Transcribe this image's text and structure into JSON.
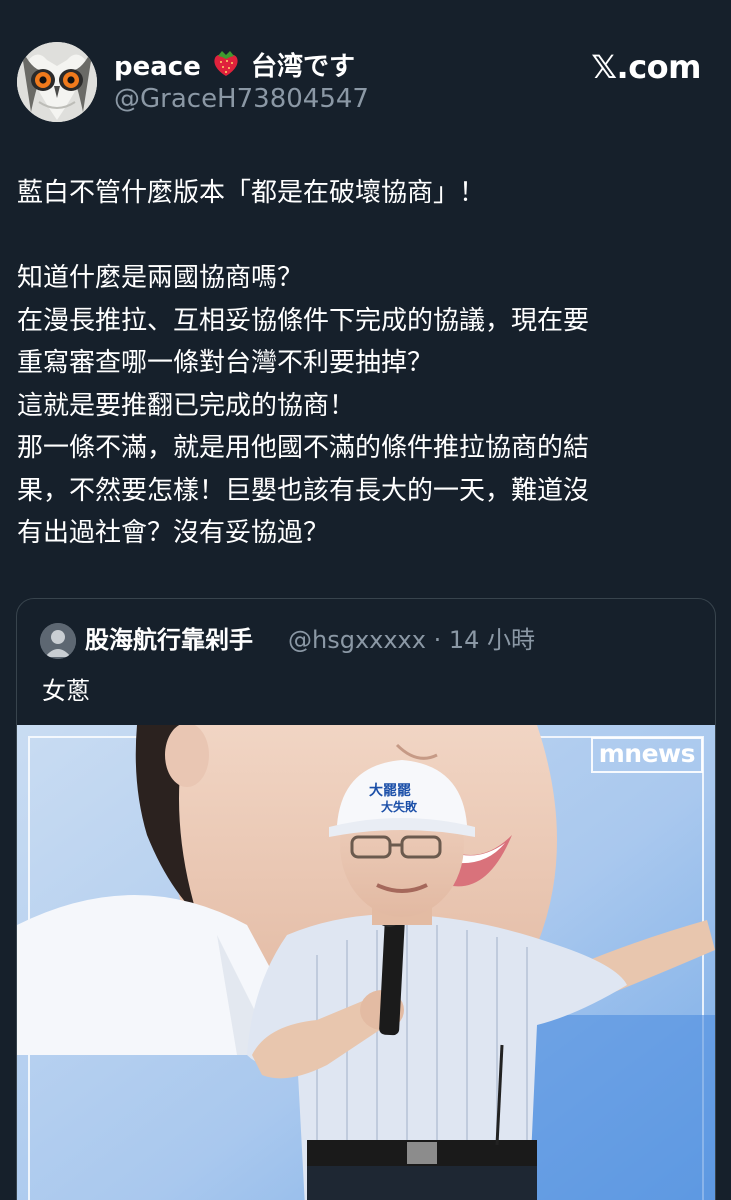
{
  "post": {
    "display_name": "peace",
    "display_name_suffix": "台湾です",
    "handle": "@GraceH73804547",
    "brand_label": "𝕏.com",
    "paragraphs": [
      "藍白不管什麼版本「都是在破壞協商」！",
      "",
      "知道什麼是兩國協商嗎？",
      "在漫長推拉、互相妥協條件下完成的協議，現在要",
      "重寫審查哪一條對台灣不利要抽掉？",
      "這就是要推翻已完成的協商！",
      "那一條不滿，就是用他國不滿的條件推拉協商的結",
      "果，不然要怎樣！巨嬰也該有長大的一天，難道沒",
      "有出過社會？沒有妥協過？"
    ]
  },
  "quoted": {
    "display_name": "股海航行靠剁手",
    "meta": "@hsgxxxxx · 14 小時",
    "text": "女蔥",
    "image": {
      "watermark": "mnews",
      "cap_text_line1": "大罷罷",
      "cap_text_line2": "大失敗"
    }
  },
  "icons": {
    "avatar": "owl-avatar",
    "strawberry": "strawberry-emoji",
    "quoted_avatar": "user-avatar"
  },
  "colors": {
    "background": "#16202b",
    "secondary_text": "#8b98a5",
    "border": "#38444d"
  }
}
